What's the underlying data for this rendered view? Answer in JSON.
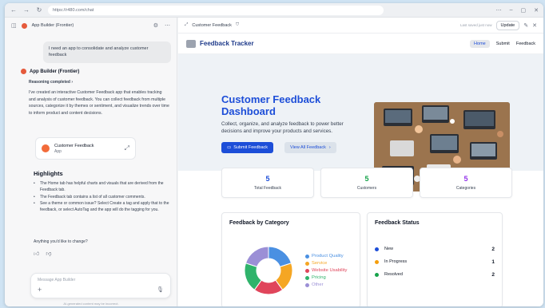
{
  "browser": {
    "url": "https://r480.com/chat"
  },
  "left": {
    "app_name": "App Builder (Frontier)",
    "user_message": "I need an app to consolidate and analyze customer feedback",
    "bot_name": "App Builder (Frontier)",
    "reasoning": "Reasoning completed",
    "bot_text": "I've created an interactive Customer Feedback app that enables tracking and analysis of customer feedback. You can collect feedback from multiple sources, categorize it by themes or sentiment, and visualize trends over time to inform product and content decisions.",
    "app_card": {
      "title": "Customer Feedback",
      "subtitle": "App"
    },
    "highlights_title": "Highlights",
    "highlights": [
      "The Home tab has helpful charts and visuals that are derived from the Feedback tab.",
      "The Feedback tab contains a list of all customer comments.",
      "See a theme or common issue? Select Create a tag and apply that to the feedback, or select AutoTag and the app will do the tagging for you."
    ],
    "ask": "Anything you'd like to change?",
    "message_placeholder": "Message App Builder",
    "disclaimer": "AI-generated content may be incorrect."
  },
  "right": {
    "tab_title": "Customer Feedback",
    "saved_text": "Last saved just now",
    "update_label": "Update",
    "brand": "Feedback Tracker",
    "nav": [
      "Home",
      "Submit",
      "Feedback"
    ],
    "hero_title": "Customer Feedback Dashboard",
    "hero_sub": "Collect, organize, and analyze feedback to power better decisions and improve your products and services.",
    "btn_submit": "Submit Feedback",
    "btn_view": "View All Feedback",
    "stats": [
      {
        "value": "5",
        "label": "Total Feedback",
        "color": "#1d4ed8"
      },
      {
        "value": "5",
        "label": "Customers",
        "color": "#16a34a"
      },
      {
        "value": "5",
        "label": "Categories",
        "color": "#9333ea"
      }
    ],
    "category_title": "Feedback by Category",
    "status_title": "Feedback Status",
    "status": [
      {
        "label": "New",
        "count": "2",
        "color": "#1d4ed8"
      },
      {
        "label": "In Progress",
        "count": "1",
        "color": "#f59e0b"
      },
      {
        "label": "Resolved",
        "count": "2",
        "color": "#16a34a"
      }
    ]
  },
  "chart_data": {
    "type": "pie",
    "categories": [
      "Product Quality",
      "Service",
      "Website Usability",
      "Pricing",
      "Other"
    ],
    "values": [
      1,
      1,
      1,
      1,
      1
    ],
    "colors": [
      "#4a90e2",
      "#f5a623",
      "#e0455b",
      "#2fb36b",
      "#9b8fd6"
    ],
    "legend_position": "right"
  }
}
